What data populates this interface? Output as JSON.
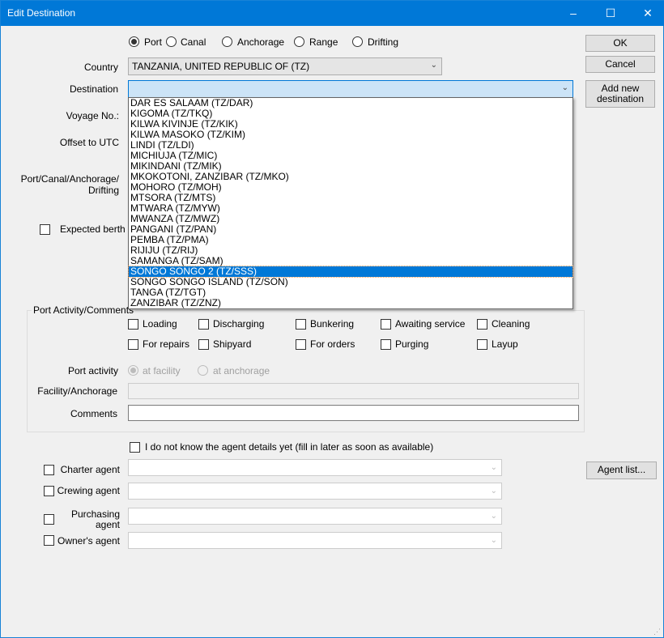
{
  "window": {
    "title": "Edit Destination",
    "controls": {
      "minimize": "–",
      "maximize": "☐",
      "close": "✕"
    }
  },
  "type_options": [
    {
      "label": "Port",
      "selected": true
    },
    {
      "label": "Canal",
      "selected": false
    },
    {
      "label": "Anchorage",
      "selected": false
    },
    {
      "label": "Range",
      "selected": false
    },
    {
      "label": "Drifting",
      "selected": false
    }
  ],
  "country": {
    "label": "Country",
    "value": "TANZANIA, UNITED REPUBLIC OF (TZ)"
  },
  "destination": {
    "label": "Destination",
    "value": "",
    "options": [
      "DAR ES SALAAM (TZ/DAR)",
      "KIGOMA (TZ/TKQ)",
      "KILWA KIVINJE (TZ/KIK)",
      "KILWA MASOKO (TZ/KIM)",
      "LINDI (TZ/LDI)",
      "MICHIUJA (TZ/MIC)",
      "MIKINDANI (TZ/MIK)",
      "MKOKOTONI, ZANZIBAR (TZ/MKO)",
      "MOHORO (TZ/MOH)",
      "MTSORA (TZ/MTS)",
      "MTWARA (TZ/MYW)",
      "MWANZA (TZ/MWZ)",
      "PANGANI (TZ/PAN)",
      "PEMBA (TZ/PMA)",
      "RIJIJU (TZ/RIJ)",
      "SAMANGA (TZ/SAM)",
      "SONGO SONGO 2 (TZ/SSS)",
      "SONGO SONGO ISLAND (TZ/SON)",
      "TANGA (TZ/TGT)",
      "ZANZIBAR (TZ/ZNZ)"
    ],
    "highlighted": "SONGO SONGO 2 (TZ/SSS)"
  },
  "labels": {
    "voyage": "Voyage No.:",
    "offset": "Offset to UTC",
    "pcad1": "Port/Canal/Anchorage/",
    "pcad2": "Drifting",
    "expected_berth": "Expected berth"
  },
  "buttons": {
    "ok": "OK",
    "cancel": "Cancel",
    "add1": "Add new",
    "add2": "destination",
    "agent_list": "Agent list..."
  },
  "activity": {
    "group_label": "Port Activity/Comments",
    "checks": [
      "Loading",
      "Discharging",
      "Bunkering",
      "Awaiting service",
      "Cleaning",
      "For repairs",
      "Shipyard",
      "For orders",
      "Purging",
      "Layup"
    ],
    "port_activity_label": "Port activity",
    "at_facility": "at facility",
    "at_anchorage": "at anchorage",
    "facility_label": "Facility/Anchorage",
    "facility_value": "",
    "comments_label": "Comments",
    "comments_value": ""
  },
  "agents": {
    "unknown_label": "I do not know the agent details yet (fill in later as soon as available)",
    "rows": [
      {
        "label": "Charter agent",
        "value": ""
      },
      {
        "label": "Crewing agent",
        "value": ""
      },
      {
        "label1": "Purchasing",
        "label2": "agent",
        "value": ""
      },
      {
        "label": "Owner's agent",
        "value": ""
      }
    ]
  },
  "colors": {
    "accent": "#0078d7",
    "dest_bg": "#cce4f7"
  }
}
